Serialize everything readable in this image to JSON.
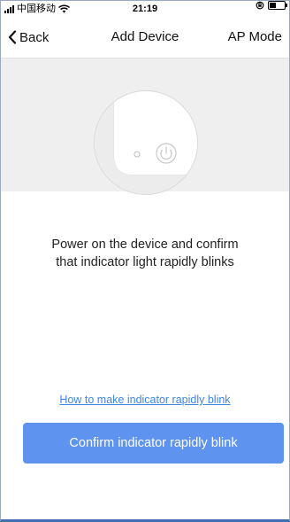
{
  "status_bar": {
    "carrier": "中国移动",
    "time": "21:19",
    "battery_level": 0.45
  },
  "nav": {
    "back_label": "Back",
    "title": "Add Device",
    "right_label": "AP Mode"
  },
  "instruction": {
    "line1": "Power on the device and confirm",
    "line2": "that indicator light rapidly blinks"
  },
  "help_link": "How to make indicator rapidly blink",
  "confirm_button": "Confirm indicator rapidly blink",
  "colors": {
    "accent": "#5e93ef",
    "link": "#3f86e6",
    "illustration_bg": "#efefef"
  }
}
